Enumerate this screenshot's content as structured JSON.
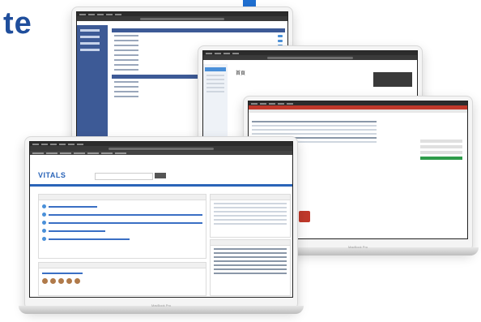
{
  "headline": "te",
  "front_app": {
    "logo": "VITALS",
    "logo_tagline": "",
    "logout_label": "",
    "panels": [
      "",
      "",
      ""
    ]
  },
  "second_app": {
    "page_title": "首頁"
  },
  "device_brand": "MacBook Pro",
  "colors": {
    "brand_blue": "#1f4e9c",
    "sidebar_blue": "#3d5a96",
    "accent_red": "#c0392b",
    "accent_green": "#2e9b4a"
  }
}
